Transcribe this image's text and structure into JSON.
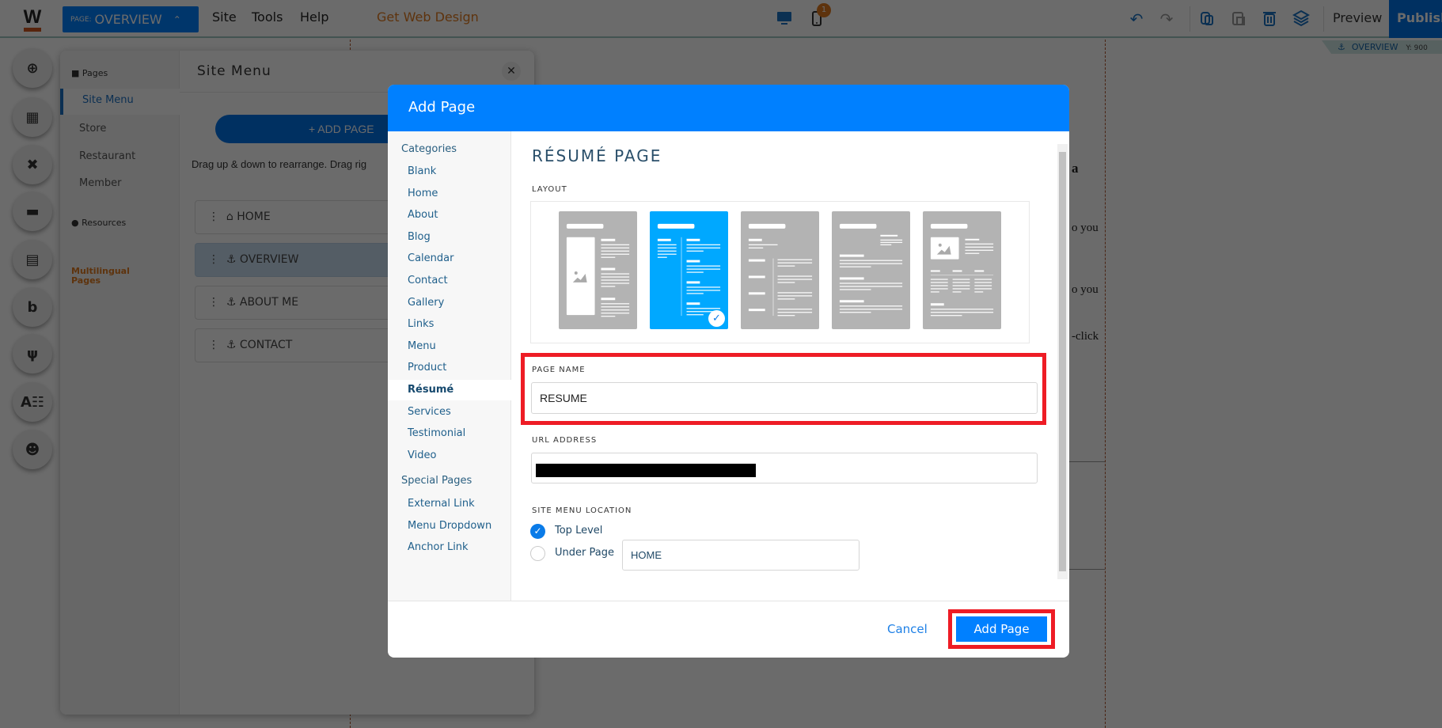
{
  "topbar": {
    "logo": "W",
    "page_prefix": "PAGE:",
    "page_name": "OVERVIEW",
    "menus": [
      "Site",
      "Tools",
      "Help"
    ],
    "promo": "Get Web Design",
    "mobile_badge": "1",
    "preview": "Preview",
    "publish": "Publish",
    "section_tag": "OVERVIEW",
    "section_y": "Y: 900",
    "icons": [
      "desktop-icon",
      "mobile-icon",
      "undo-icon",
      "redo-icon",
      "copy-icon",
      "paste-icon",
      "trash-icon",
      "layers-icon"
    ]
  },
  "left_tools": [
    "add-icon",
    "layout-icon",
    "design-icon",
    "folder-icon",
    "store-icon",
    "blog-icon",
    "restaurant-icon",
    "translate-icon",
    "members-icon"
  ],
  "site_menu": {
    "nav_pages": "Pages",
    "nav_items": [
      "Site Menu",
      "Store",
      "Restaurant",
      "Member"
    ],
    "nav_resources": "Resources",
    "nav_multilingual": "Multilingual Pages",
    "title": "Site Menu",
    "add_page": "+ ADD PAGE",
    "hint": "Drag up & down to rearrange. Drag rig",
    "pages": [
      "HOME",
      "OVERVIEW",
      "ABOUT ME",
      "CONTACT"
    ]
  },
  "background_text": [
    "a",
    "o you",
    "o you",
    "-click"
  ],
  "modal": {
    "title": "Add Page",
    "categories_label": "Categories",
    "categories": [
      "Blank",
      "Home",
      "About",
      "Blog",
      "Calendar",
      "Contact",
      "Gallery",
      "Links",
      "Menu",
      "Product",
      "Résumé",
      "Services",
      "Testimonial",
      "Video"
    ],
    "selected_category": "Résumé",
    "special_label": "Special Pages",
    "special": [
      "External Link",
      "Menu Dropdown",
      "Anchor Link"
    ],
    "heading": "RÉSUMÉ PAGE",
    "layout_label": "LAYOUT",
    "selected_layout": 2,
    "layout_count": 5,
    "page_name_label": "PAGE NAME",
    "page_name_value": "RESUME",
    "url_label": "URL ADDRESS",
    "location_label": "SITE MENU LOCATION",
    "top_level": "Top Level",
    "under_page": "Under Page",
    "under_page_value": "HOME",
    "location_selected": "Top Level",
    "cancel": "Cancel",
    "add": "Add Page"
  },
  "colors": {
    "accent": "#0080ff",
    "selected_layout": "#00a8ff",
    "highlight": "#ee1c25",
    "promo": "#e07a1f"
  }
}
